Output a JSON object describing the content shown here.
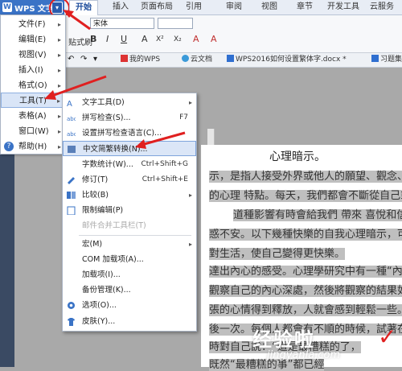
{
  "app": {
    "title": "WPS 文字",
    "logo_text": "W",
    "caret": "▾"
  },
  "tabs": [
    "开始",
    "插入",
    "页面布局",
    "引用",
    "审阅",
    "视图",
    "章节",
    "开发工具",
    "云服务"
  ],
  "ribbon": {
    "font_name": "宋体",
    "paste_label": "贴式刷",
    "format_buttons": [
      "B",
      "I",
      "U",
      "A",
      "X²",
      "X₂",
      "A",
      "A"
    ]
  },
  "doc_tabs": [
    "我的WPS",
    "云文档",
    "WPS2016如何设置繁体字.docx *",
    "习题集"
  ],
  "main_menu": [
    {
      "label": "文件(F)",
      "has_arrow": true
    },
    {
      "label": "编辑(E)",
      "has_arrow": true
    },
    {
      "label": "视图(V)",
      "has_arrow": true
    },
    {
      "label": "插入(I)",
      "has_arrow": true
    },
    {
      "label": "格式(O)",
      "has_arrow": true
    },
    {
      "label": "工具(T)",
      "has_arrow": true,
      "selected": true
    },
    {
      "label": "表格(A)",
      "has_arrow": true
    },
    {
      "label": "窗口(W)",
      "has_arrow": true
    },
    {
      "label": "帮助(H)",
      "has_arrow": true,
      "help_icon": "?"
    }
  ],
  "tools_submenu": [
    {
      "label": "文字工具(D)",
      "shortcut": "",
      "arrow": true,
      "icon": "text-tools-icon"
    },
    {
      "label": "拼写检查(S)...",
      "shortcut": "F7",
      "icon": "spell-check-icon"
    },
    {
      "label": "设置拼写检查语言(C)...",
      "shortcut": "",
      "icon": "spell-language-icon"
    },
    {
      "label": "中文简繁转换(N)...",
      "shortcut": "",
      "icon": "chinese-convert-icon",
      "selected": true
    },
    {
      "label": "字数统计(W)...",
      "shortcut": "Ctrl+Shift+G",
      "icon": "word-count-icon"
    },
    {
      "label": "修订(T)",
      "shortcut": "Ctrl+Shift+E",
      "icon": "revision-icon"
    },
    {
      "label": "比较(B)",
      "shortcut": "",
      "arrow": true,
      "icon": "compare-icon"
    },
    {
      "label": "限制编辑(P)",
      "shortcut": "",
      "icon": "restrict-edit-icon"
    },
    {
      "label": "邮件合并工具栏(T)",
      "shortcut": "",
      "disabled": true,
      "icon": "mail-merge-icon"
    },
    {
      "label": "宏(M)",
      "shortcut": "",
      "arrow": true,
      "icon": "macro-icon"
    },
    {
      "label": "COM 加载项(A)...",
      "shortcut": "",
      "icon": "com-addin-icon"
    },
    {
      "label": "加载项(I)...",
      "shortcut": "",
      "icon": "addin-icon"
    },
    {
      "label": "备份管理(K)...",
      "shortcut": "",
      "icon": "backup-icon"
    },
    {
      "label": "选项(O)...",
      "shortcut": "",
      "icon": "options-icon"
    },
    {
      "label": "皮肤(Y)...",
      "shortcut": "",
      "icon": "skin-icon"
    }
  ],
  "document": {
    "title": "心理暗示。",
    "lines": [
      "示，是指人接受外界或他人的願望、觀念、",
      "的心理 特點。每天，我們都會不斷從自己或他",
      "道種影響有時會給我們 帶來 喜悅和信心",
      "惑不安。以下幾種快樂的自我心理暗示，可",
      "對生活，使自己變得更快樂。",
      "達出內心的感受。心理學研究中有一種“內",
      "觀察自己的內心深處，然後將觀察的結果如",
      "張的心情得到釋放，人就會感到輕鬆一些。",
      "後一次。每個人都會有不順的時候，試著在",
      "時對自己說：“道是最糟糕的了，",
      "既然“最糟糕的事”都已經"
    ]
  },
  "watermark": {
    "text": "经验啦",
    "url": "jingyanla.com",
    "check": "✓"
  },
  "colors": {
    "accent": "#3a73c6",
    "annotation": "#e02020"
  }
}
